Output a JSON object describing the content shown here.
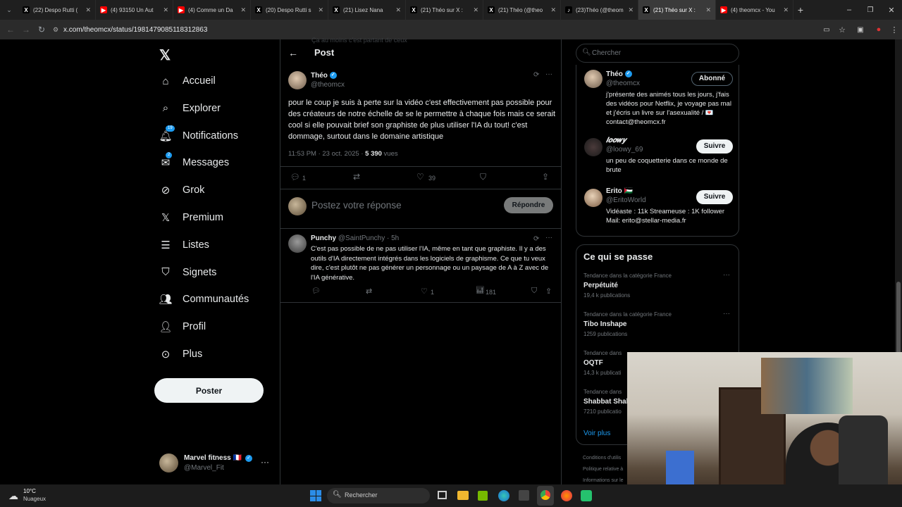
{
  "browser": {
    "tabs": [
      {
        "label": "(22) Despo Rutti (",
        "fav": "X",
        "favcolor": "#000000"
      },
      {
        "label": "(4) 93150 Un Aut",
        "fav": "▶",
        "favcolor": "#ff0000"
      },
      {
        "label": "(4) Comme un Da",
        "fav": "▶",
        "favcolor": "#ff0000"
      },
      {
        "label": "(20) Despo Rutti s",
        "fav": "X",
        "favcolor": "#000000"
      },
      {
        "label": "(21) Lisez Nana",
        "fav": "X",
        "favcolor": "#000000"
      },
      {
        "label": "(21) Théo sur X :",
        "fav": "X",
        "favcolor": "#000000"
      },
      {
        "label": "(21) Théo (@theo",
        "fav": "X",
        "favcolor": "#000000"
      },
      {
        "label": "(23)Théo (@theom",
        "fav": "♪",
        "favcolor": "#000000"
      },
      {
        "label": "(21) Théo sur X :",
        "fav": "X",
        "favcolor": "#000000"
      },
      {
        "label": "(4) theomcx - You",
        "fav": "▶",
        "favcolor": "#ff0000"
      }
    ],
    "url": "x.com/theomcx/status/1981479085118312863"
  },
  "nav": {
    "items": [
      {
        "label": "Accueil",
        "icon": "home-icon"
      },
      {
        "label": "Explorer",
        "icon": "search-icon"
      },
      {
        "label": "Notifications",
        "icon": "bell-icon",
        "badge": "19"
      },
      {
        "label": "Messages",
        "icon": "mail-icon",
        "badge": "2"
      },
      {
        "label": "Grok",
        "icon": "grok-icon"
      },
      {
        "label": "Premium",
        "icon": "x-logo-icon"
      },
      {
        "label": "Listes",
        "icon": "list-icon"
      },
      {
        "label": "Signets",
        "icon": "bookmark-icon"
      },
      {
        "label": "Communautés",
        "icon": "people-icon"
      },
      {
        "label": "Profil",
        "icon": "person-icon"
      },
      {
        "label": "Plus",
        "icon": "more-circle-icon"
      }
    ],
    "post_button": "Poster",
    "account": {
      "name": "Marvel fitness 🇫🇷",
      "handle": "@Marvel_Fit"
    }
  },
  "post": {
    "header_title": "Post",
    "top_partial_text": "Ça au moins c'est partant de ceux",
    "author_name": "Théo",
    "author_handle": "@theomcx",
    "text": "pour le coup je suis à perte sur la vidéo c'est effectivement pas possible pour des créateurs de notre échelle de se le permettre à chaque fois mais ce serait cool si elle pouvait brief son graphiste de plus utiliser l'IA du tout! c'est dommage, surtout dans le domaine artistique",
    "time": "11:53 PM · 23 oct. 2025 · ",
    "views_count": "5 390",
    "views_label": " vues",
    "replies": "1",
    "retweets": "",
    "likes": "39",
    "reply_placeholder": "Postez votre réponse",
    "reply_button": "Répondre"
  },
  "reply": {
    "name": "Punchy",
    "handle": "@SaintPunchy · 5h",
    "text": "C'est pas possible de ne pas utiliser l'IA, même en tant que graphiste. Il y a des outils d'IA directement intégrés dans les logiciels de graphisme. Ce que tu veux dire, c'est plutôt ne pas générer un personnage ou un paysage de A à Z avec de l'IA générative.",
    "likes": "1",
    "views": "181"
  },
  "right": {
    "search_placeholder": "Chercher",
    "profile_card": {
      "name": "Théo",
      "handle": "@theomcx",
      "button": "Abonné",
      "bio": "j'présente des animés tous les jours, j'fais des vidéos pour Netflix, je voyage pas mal et j'écris un livre sur l'asexualité / 💌 contact@theomcx.fr"
    },
    "suggestions": [
      {
        "name": "𝒍𝒐𝒐𝒘𝒚",
        "handle": "@loowy_69",
        "bio": "un peu de coquetterie dans ce monde de brute",
        "button": "Suivre"
      },
      {
        "name": "Erito 🇵🇸",
        "handle": "@EritoWorld",
        "bio": "Vidéaste : 11k Streameuse : 1K follower Mail: erito@stellar-media.fr",
        "button": "Suivre"
      }
    ],
    "trends_title": "Ce qui se passe",
    "trends": [
      {
        "cat": "Tendance dans la catégorie France",
        "name": "Perpétuité",
        "count": "19,4 k publications"
      },
      {
        "cat": "Tendance dans la catégorie France",
        "name": "Tibo Inshape",
        "count": "1259 publications"
      },
      {
        "cat": "Tendance dans",
        "name": "OQTF",
        "count": "14,3 k publicati"
      },
      {
        "cat": "Tendance dans",
        "name": "Shabbat Shal",
        "count": "7210 publicatio"
      }
    ],
    "show_more": "Voir plus",
    "footer": [
      "Conditions d'utilis",
      "Politique relative à",
      "Informations sur le"
    ]
  },
  "taskbar": {
    "weather_temp": "10°C",
    "weather_desc": "Nuageux",
    "search": "Rechercher"
  },
  "colors": {
    "accent": "#1d9bf0",
    "bg": "#000000",
    "border": "#2f3336",
    "muted": "#71767b"
  }
}
